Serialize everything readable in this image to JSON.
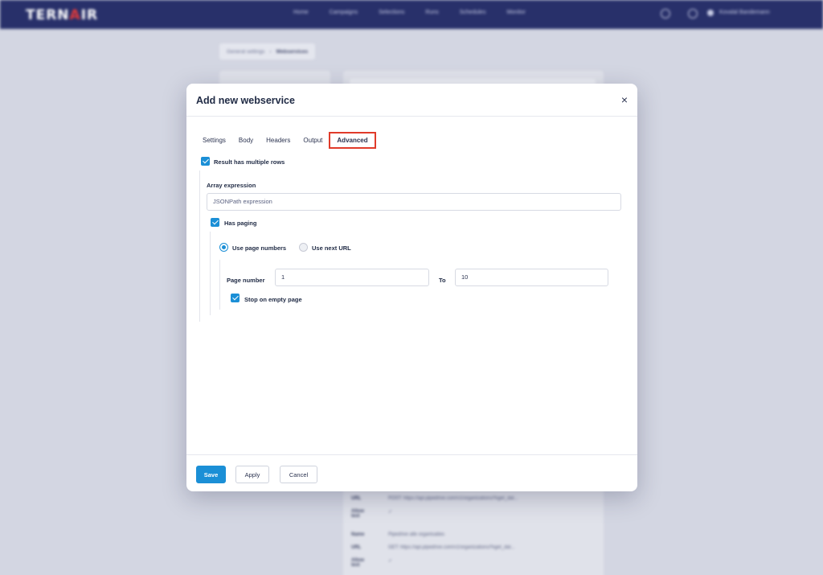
{
  "background": {
    "logo": {
      "text_a": "TERN",
      "text_b": "A",
      "text_c": "IR"
    },
    "nav": [
      "Home",
      "Campaigns",
      "Selections",
      "Runs",
      "Schedules",
      "Monitor"
    ],
    "user_name": "Kovalal Bandemann",
    "breadcrumb": {
      "parent": "General settings",
      "current": "Webservices"
    },
    "rows": [
      {
        "label": "URL",
        "value": "POST: https://api.pipedrive.com/v1/organizations/%get_dat..."
      },
      {
        "label": "Allow text",
        "value": "✓"
      },
      {
        "label": "Name",
        "value": "Pipedrive alle organisaties"
      },
      {
        "label": "URL",
        "value": "GET: https://api.pipedrive.com/v1/organizations/%get_dat..."
      },
      {
        "label": "Allow text",
        "value": "✓"
      }
    ]
  },
  "modal": {
    "title": "Add new webservice",
    "close_symbol": "×",
    "tabs": [
      {
        "label": "Settings",
        "active": false
      },
      {
        "label": "Body",
        "active": false
      },
      {
        "label": "Headers",
        "active": false
      },
      {
        "label": "Output",
        "active": false
      },
      {
        "label": "Advanced",
        "active": true
      }
    ],
    "result_multiple_rows": {
      "label": "Result has multiple rows",
      "checked": true
    },
    "array_expression": {
      "label": "Array expression",
      "placeholder": "JSONPath expression",
      "value": ""
    },
    "has_paging": {
      "label": "Has paging",
      "checked": true
    },
    "paging_mode": {
      "options": [
        {
          "label": "Use page numbers",
          "selected": true
        },
        {
          "label": "Use next URL",
          "selected": false
        }
      ]
    },
    "page_number": {
      "label": "Page number",
      "from_value": "1",
      "to_label": "To",
      "to_value": "10"
    },
    "stop_on_empty": {
      "label": "Stop on empty page",
      "checked": true
    },
    "footer": {
      "save": "Save",
      "apply": "Apply",
      "cancel": "Cancel"
    }
  },
  "colors": {
    "primary": "#1b8fd6",
    "topbar": "#28306a",
    "highlight": "#e03b2a"
  }
}
